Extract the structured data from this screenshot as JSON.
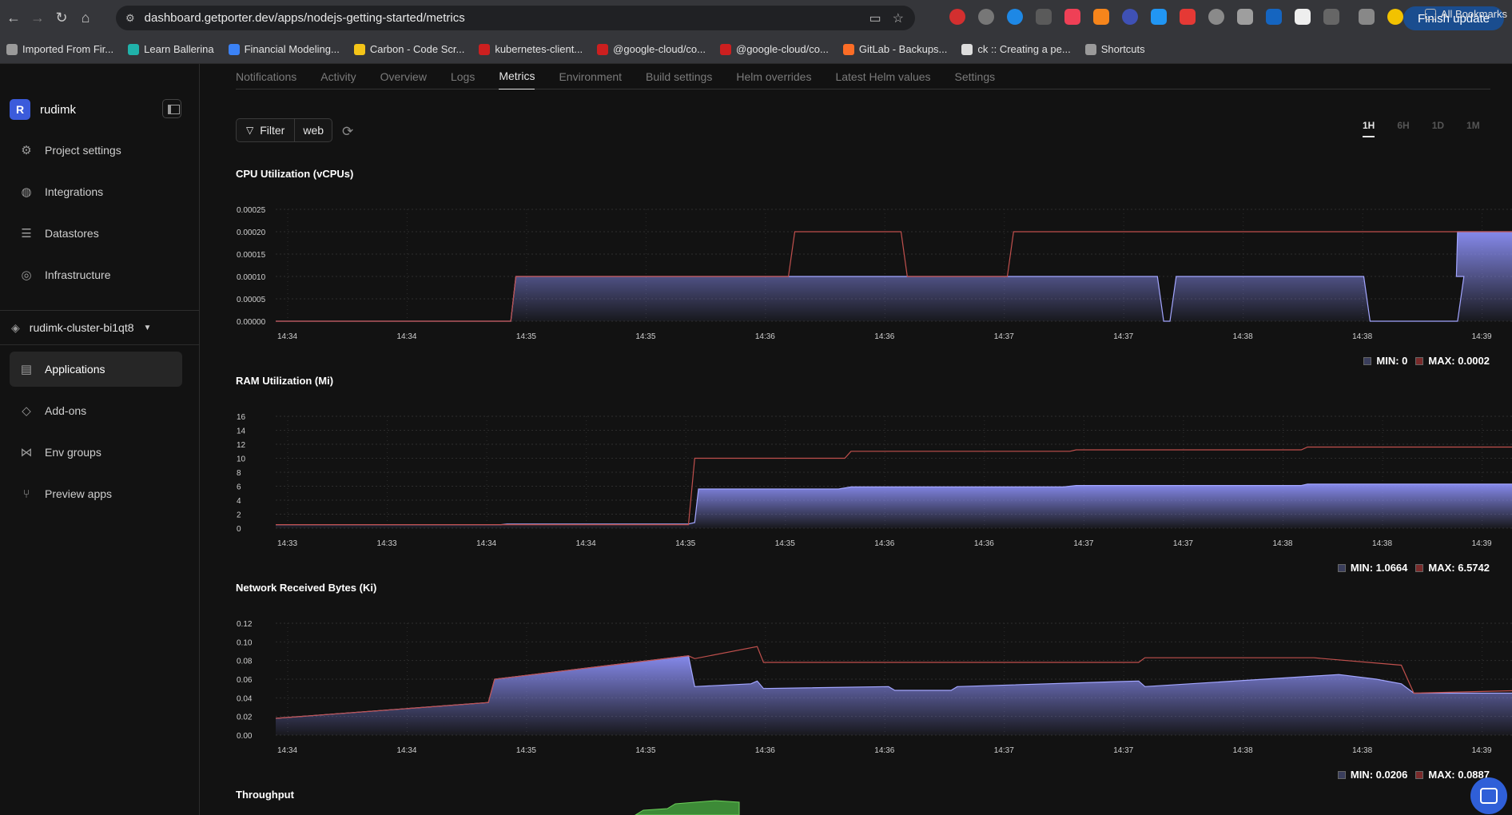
{
  "browser": {
    "url": "dashboard.getporter.dev/apps/nodejs-getting-started/metrics",
    "finish_update": "Finish update",
    "bookmarks": [
      {
        "label": "Imported From Fir...",
        "color": "#9a9a9a"
      },
      {
        "label": "Learn Ballerina",
        "color": "#20b2aa"
      },
      {
        "label": "Financial Modeling...",
        "color": "#3b82f6"
      },
      {
        "label": "Carbon - Code Scr...",
        "color": "#f5c518"
      },
      {
        "label": "kubernetes-client...",
        "color": "#cc1f1f"
      },
      {
        "label": "@google-cloud/co...",
        "color": "#cc1f1f"
      },
      {
        "label": "@google-cloud/co...",
        "color": "#cc1f1f"
      },
      {
        "label": "GitLab - Backups...",
        "color": "#fc6d26"
      },
      {
        "label": "ck :: Creating a pe...",
        "color": "#dddddd"
      },
      {
        "label": "Shortcuts",
        "color": "#9a9a9a"
      }
    ],
    "all_bookmarks": "All Bookmarks"
  },
  "sidebar": {
    "project_initial": "R",
    "project_name": "rudimk",
    "top_items": [
      {
        "label": "Project settings",
        "icon": "gear-icon"
      },
      {
        "label": "Integrations",
        "icon": "integrations-icon"
      },
      {
        "label": "Datastores",
        "icon": "database-icon"
      },
      {
        "label": "Infrastructure",
        "icon": "infrastructure-icon"
      }
    ],
    "cluster": "rudimk-cluster-bi1qt8",
    "bottom_items": [
      {
        "label": "Applications",
        "icon": "applications-icon",
        "active": true
      },
      {
        "label": "Add-ons",
        "icon": "layers-icon"
      },
      {
        "label": "Env groups",
        "icon": "share-icon"
      },
      {
        "label": "Preview apps",
        "icon": "git-branch-icon"
      }
    ]
  },
  "tabs": [
    "Notifications",
    "Activity",
    "Overview",
    "Logs",
    "Metrics",
    "Environment",
    "Build settings",
    "Helm overrides",
    "Latest Helm values",
    "Settings"
  ],
  "active_tab": "Metrics",
  "filter": {
    "label": "Filter",
    "value": "web"
  },
  "ranges": [
    "1H",
    "6H",
    "1D",
    "1M"
  ],
  "active_range": "1H",
  "colors": {
    "area": "#8b8ff5",
    "max_line": "#c0504d",
    "grid": "#2d2d2d"
  },
  "chart_data": [
    {
      "type": "area",
      "title": "CPU Utilization (vCPUs)",
      "yticks": [
        "0.00025",
        "0.00020",
        "0.00015",
        "0.00010",
        "0.00005",
        "0.00000"
      ],
      "ylim": [
        0,
        0.00025
      ],
      "xticks": [
        "14:34",
        "14:34",
        "14:35",
        "14:35",
        "14:36",
        "14:36",
        "14:37",
        "14:37",
        "14:38",
        "14:38",
        "14:39"
      ],
      "series": [
        {
          "name": "avg",
          "points": [
            [
              0,
              0
            ],
            [
              0.188,
              0
            ],
            [
              0.192,
              0.0001
            ],
            [
              0.7,
              0.0001
            ],
            [
              0.705,
              0.0001
            ],
            [
              0.71,
              0
            ],
            [
              0.715,
              0
            ],
            [
              0.72,
              0.0001
            ],
            [
              0.87,
              0.0001
            ],
            [
              0.875,
              0
            ],
            [
              0.945,
              0
            ],
            [
              0.95,
              0.0001
            ],
            [
              0.944,
              0.0001
            ],
            [
              0.945,
              0.0002
            ],
            [
              1,
              0.0002
            ]
          ]
        },
        {
          "name": "max",
          "points": [
            [
              0,
              0
            ],
            [
              0.188,
              0
            ],
            [
              0.192,
              0.0001
            ],
            [
              0.41,
              0.0001
            ],
            [
              0.415,
              0.0002
            ],
            [
              0.5,
              0.0002
            ],
            [
              0.505,
              0.0001
            ],
            [
              0.585,
              0.0001
            ],
            [
              0.59,
              0.0002
            ],
            [
              1,
              0.0002
            ]
          ]
        }
      ],
      "legend": {
        "min": "MIN: 0",
        "max": "MAX: 0.0002"
      }
    },
    {
      "type": "area",
      "title": "RAM Utilization (Mi)",
      "yticks": [
        "16",
        "14",
        "12",
        "10",
        "8",
        "6",
        "4",
        "2",
        "0"
      ],
      "ylim": [
        0,
        16
      ],
      "xticks": [
        "14:33",
        "14:33",
        "14:34",
        "14:34",
        "14:35",
        "14:35",
        "14:36",
        "14:36",
        "14:37",
        "14:37",
        "14:38",
        "14:38",
        "14:39"
      ],
      "series": [
        {
          "name": "avg",
          "points": [
            [
              0,
              0.5
            ],
            [
              0.18,
              0.5
            ],
            [
              0.185,
              0.6
            ],
            [
              0.33,
              0.6
            ],
            [
              0.335,
              0.8
            ],
            [
              0.338,
              5.6
            ],
            [
              0.45,
              5.6
            ],
            [
              0.46,
              5.9
            ],
            [
              0.63,
              5.9
            ],
            [
              0.64,
              6.1
            ],
            [
              0.82,
              6.1
            ],
            [
              0.825,
              6.3
            ],
            [
              1,
              6.3
            ]
          ]
        },
        {
          "name": "max",
          "points": [
            [
              0,
              0.5
            ],
            [
              0.33,
              0.5
            ],
            [
              0.335,
              10
            ],
            [
              0.455,
              10
            ],
            [
              0.46,
              11
            ],
            [
              0.635,
              11
            ],
            [
              0.64,
              11.2
            ],
            [
              0.82,
              11.2
            ],
            [
              0.825,
              11.6
            ],
            [
              1,
              11.6
            ]
          ]
        }
      ],
      "legend": {
        "min": "MIN: 1.0664",
        "max": "MAX: 6.5742"
      }
    },
    {
      "type": "area",
      "title": "Network Received Bytes (Ki)",
      "yticks": [
        "0.12",
        "0.10",
        "0.08",
        "0.06",
        "0.04",
        "0.02",
        "0.00"
      ],
      "ylim": [
        0,
        0.12
      ],
      "xticks": [
        "14:34",
        "14:34",
        "14:35",
        "14:35",
        "14:36",
        "14:36",
        "14:37",
        "14:37",
        "14:38",
        "14:38",
        "14:39"
      ],
      "series": [
        {
          "name": "avg",
          "points": [
            [
              0,
              0.018
            ],
            [
              0.17,
              0.035
            ],
            [
              0.175,
              0.06
            ],
            [
              0.33,
              0.085
            ],
            [
              0.335,
              0.052
            ],
            [
              0.38,
              0.055
            ],
            [
              0.385,
              0.058
            ],
            [
              0.39,
              0.05
            ],
            [
              0.49,
              0.052
            ],
            [
              0.495,
              0.048
            ],
            [
              0.54,
              0.048
            ],
            [
              0.545,
              0.052
            ],
            [
              0.69,
              0.058
            ],
            [
              0.695,
              0.052
            ],
            [
              0.85,
              0.065
            ],
            [
              0.88,
              0.06
            ],
            [
              0.9,
              0.055
            ],
            [
              0.91,
              0.045
            ],
            [
              1,
              0.045
            ]
          ]
        },
        {
          "name": "max",
          "points": [
            [
              0,
              0.018
            ],
            [
              0.17,
              0.035
            ],
            [
              0.175,
              0.06
            ],
            [
              0.33,
              0.085
            ],
            [
              0.335,
              0.082
            ],
            [
              0.385,
              0.095
            ],
            [
              0.39,
              0.078
            ],
            [
              0.69,
              0.078
            ],
            [
              0.695,
              0.083
            ],
            [
              0.83,
              0.083
            ],
            [
              0.9,
              0.075
            ],
            [
              0.91,
              0.045
            ],
            [
              1,
              0.048
            ]
          ]
        }
      ],
      "legend": {
        "min": "MIN: 0.0206",
        "max": "MAX: 0.0887"
      }
    },
    {
      "type": "area",
      "title": "Throughput",
      "series": []
    }
  ]
}
